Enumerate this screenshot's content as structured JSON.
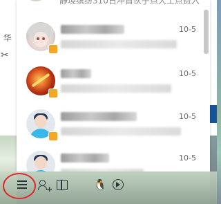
{
  "background": {
    "left_text": "华",
    "left_icon": "scissors-icon"
  },
  "top_fragment": {
    "snippet": "静境缤纷310日冲首伙子点大土点费入"
  },
  "conversations": [
    {
      "time": "10-5",
      "avatar": "anime-character-avatar",
      "name_hidden": true,
      "message_hidden": true
    },
    {
      "time": "10-5",
      "avatar": "fire-artwork-avatar",
      "name_hidden": true,
      "message_hidden": true
    },
    {
      "time": "10-5",
      "avatar": "default-person-avatar",
      "name_hidden": true,
      "message_hidden": true
    },
    {
      "time": "10-5",
      "avatar": "default-person-avatar",
      "name_hidden": true,
      "message_hidden": true
    }
  ],
  "toolbar": {
    "items": [
      {
        "icon": "menu-icon",
        "highlighted": true
      },
      {
        "icon": "add-friend-icon"
      },
      {
        "icon": "apps-icon"
      },
      {
        "icon": "penguin-icon"
      },
      {
        "icon": "play-icon"
      }
    ]
  },
  "colors": {
    "highlight_ring": "#e0262a",
    "badge": "#f5a623",
    "blue_accent": "#17539a"
  }
}
